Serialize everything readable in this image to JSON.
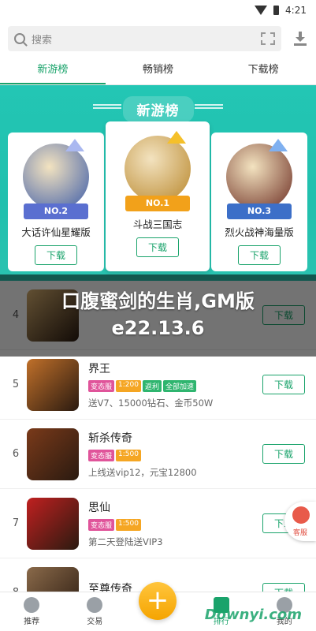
{
  "status": {
    "time": "4:21"
  },
  "search": {
    "placeholder": "搜索"
  },
  "tabs": [
    {
      "label": "新游榜"
    },
    {
      "label": "畅销榜"
    },
    {
      "label": "下载榜"
    }
  ],
  "banner": {
    "title": "新游榜"
  },
  "top3": [
    {
      "rank": "NO.2",
      "name": "大话许仙星耀版",
      "button": "下载",
      "art_color": "#3a5aa8",
      "ribbon_color": "#5a6fd0",
      "crown_color": "#aab8f0"
    },
    {
      "rank": "NO.1",
      "name": "斗战三国志",
      "button": "下载",
      "art_color": "#b8862a",
      "ribbon_color": "#f2a11a",
      "crown_color": "#f5c02a"
    },
    {
      "rank": "NO.3",
      "name": "烈火战神海量版",
      "button": "下载",
      "art_color": "#6a2a20",
      "ribbon_color": "#3c6fc8",
      "crown_color": "#7fb0f0"
    }
  ],
  "overlay": {
    "text": "口腹蜜剑的生肖,GM版e22.13.6"
  },
  "list": [
    {
      "rank": "4",
      "name": "",
      "tags": [],
      "desc": "",
      "button": "下载",
      "art_color": "#d8b070"
    },
    {
      "rank": "5",
      "name": "界王",
      "tags": [
        {
          "text": "变态服",
          "color": "#e0549a"
        },
        {
          "text": "1:200",
          "color": "#f5a623"
        },
        {
          "text": "返利",
          "color": "#2fb56f"
        },
        {
          "text": "全部加速",
          "color": "#2fb56f"
        }
      ],
      "desc": "送V7、15000钻石、金币50W",
      "button": "下载",
      "art_color": "#c0702a"
    },
    {
      "rank": "6",
      "name": "斩杀传奇",
      "tags": [
        {
          "text": "变态服",
          "color": "#e0549a"
        },
        {
          "text": "1:500",
          "color": "#f5a623"
        }
      ],
      "desc": "上线送vip12，元宝12800",
      "button": "下载",
      "art_color": "#7a3a1a"
    },
    {
      "rank": "7",
      "name": "思仙",
      "tags": [
        {
          "text": "变态服",
          "color": "#e0549a"
        },
        {
          "text": "1:500",
          "color": "#f5a623"
        }
      ],
      "desc": "第二天登陆送VIP3",
      "button": "下载",
      "art_color": "#c02020"
    },
    {
      "rank": "8",
      "name": "至尊传奇",
      "tags": [],
      "desc": "",
      "button": "下载",
      "art_color": "#8a6a4a"
    }
  ],
  "nav": [
    {
      "label": "推荐"
    },
    {
      "label": "交易"
    },
    {
      "label": ""
    },
    {
      "label": "排行"
    },
    {
      "label": "我的"
    }
  ],
  "plus": {
    "symbol": "+"
  },
  "watermark": {
    "text": "Downyi.com"
  },
  "side_badge": {
    "label": "客服"
  }
}
